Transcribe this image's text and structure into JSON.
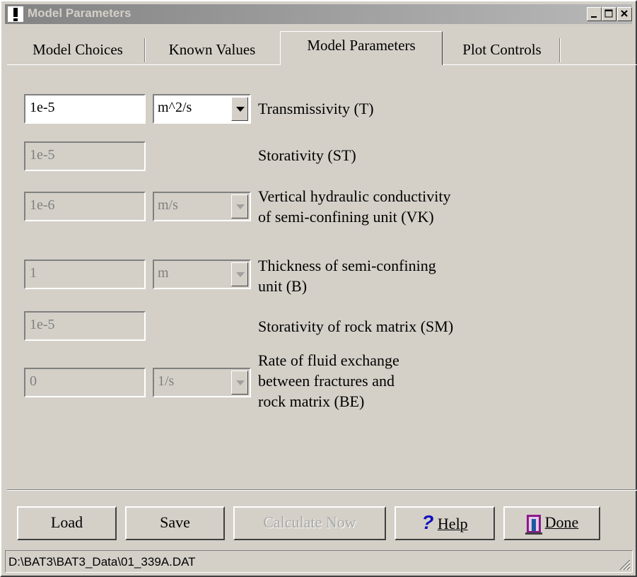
{
  "window": {
    "title": "Model Parameters"
  },
  "tabs": [
    {
      "label": "Model Choices"
    },
    {
      "label": "Known Values"
    },
    {
      "label": "Model Parameters"
    },
    {
      "label": "Plot Controls"
    }
  ],
  "params": [
    {
      "value": "1e-5",
      "unit": "m^2/s",
      "label_lines": [
        "Transmissivity (T)"
      ],
      "enabled": true
    },
    {
      "value": "1e-5",
      "unit": "",
      "label_lines": [
        "Storativity  (ST)"
      ],
      "enabled": false
    },
    {
      "value": "1e-6",
      "unit": "m/s",
      "label_lines": [
        "Vertical hydraulic conductivity",
        "of semi-confining unit (VK)"
      ],
      "enabled": false
    },
    {
      "value": "1",
      "unit": "m",
      "label_lines": [
        "Thickness of semi-confining",
        "unit (B)"
      ],
      "enabled": false
    },
    {
      "value": "1e-5",
      "unit": "",
      "label_lines": [
        "Storativity of rock matrix (SM)"
      ],
      "enabled": false
    },
    {
      "value": "0",
      "unit": "1/s",
      "label_lines": [
        "Rate of fluid exchange",
        "between fractures and",
        "rock matrix (BE)"
      ],
      "enabled": false
    }
  ],
  "buttons": {
    "load": "Load",
    "save": "Save",
    "calculate": "Calculate Now",
    "help": "Help",
    "done": "Done"
  },
  "status": {
    "path": "D:\\BAT3\\BAT3_Data\\01_339A.DAT"
  },
  "colors": {
    "face": "#d4d0c8",
    "help_icon": "#1010c0",
    "done_icon": "#8a1a8a"
  }
}
